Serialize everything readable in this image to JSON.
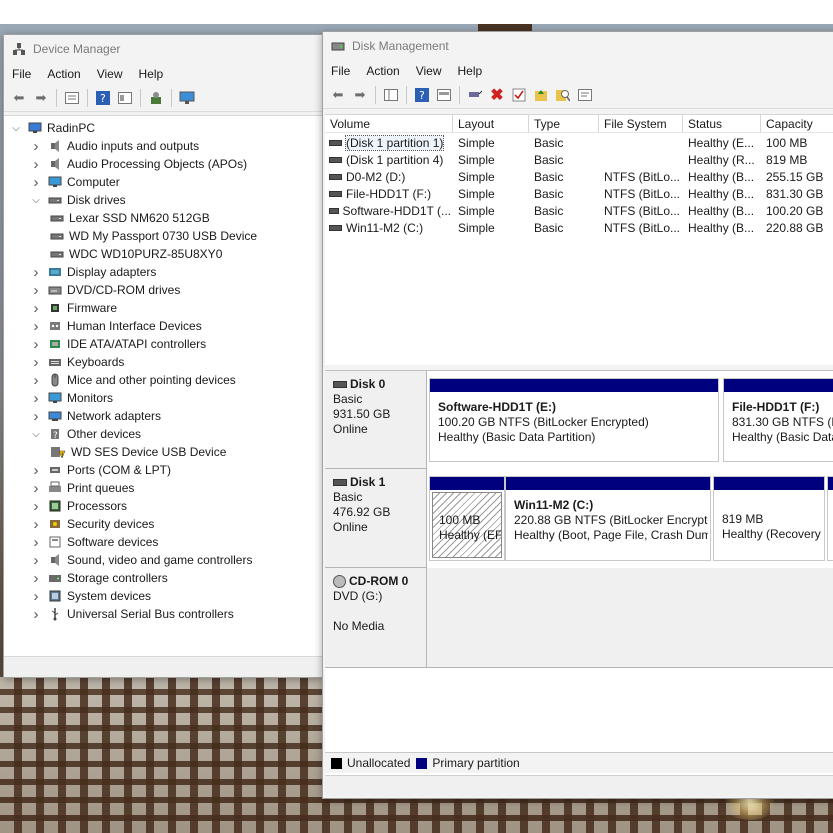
{
  "device_manager": {
    "title": "Device Manager",
    "menu": [
      "File",
      "Action",
      "View",
      "Help"
    ],
    "root": "RadinPC",
    "tree": [
      {
        "label": "Audio inputs and outputs",
        "level": 1,
        "exp": ">",
        "icon": "speaker-icon"
      },
      {
        "label": "Audio Processing Objects (APOs)",
        "level": 1,
        "exp": ">",
        "icon": "speaker-icon"
      },
      {
        "label": "Computer",
        "level": 1,
        "exp": ">",
        "icon": "monitor-icon"
      },
      {
        "label": "Disk drives",
        "level": 1,
        "exp": "v",
        "icon": "disk-drive-icon"
      },
      {
        "label": "Lexar SSD NM620 512GB",
        "level": 2,
        "exp": "",
        "icon": "disk-drive-icon"
      },
      {
        "label": "WD My Passport 0730 USB Device",
        "level": 2,
        "exp": "",
        "icon": "disk-drive-icon"
      },
      {
        "label": "WDC WD10PURZ-85U8XY0",
        "level": 2,
        "exp": "",
        "icon": "disk-drive-icon"
      },
      {
        "label": "Display adapters",
        "level": 1,
        "exp": ">",
        "icon": "display-adapter-icon"
      },
      {
        "label": "DVD/CD-ROM drives",
        "level": 1,
        "exp": ">",
        "icon": "dvd-drive-icon"
      },
      {
        "label": "Firmware",
        "level": 1,
        "exp": ">",
        "icon": "chip-icon"
      },
      {
        "label": "Human Interface Devices",
        "level": 1,
        "exp": ">",
        "icon": "hid-icon"
      },
      {
        "label": "IDE ATA/ATAPI controllers",
        "level": 1,
        "exp": ">",
        "icon": "controller-icon"
      },
      {
        "label": "Keyboards",
        "level": 1,
        "exp": ">",
        "icon": "keyboard-icon"
      },
      {
        "label": "Mice and other pointing devices",
        "level": 1,
        "exp": ">",
        "icon": "mouse-icon"
      },
      {
        "label": "Monitors",
        "level": 1,
        "exp": ">",
        "icon": "monitor-icon"
      },
      {
        "label": "Network adapters",
        "level": 1,
        "exp": ">",
        "icon": "network-adapter-icon"
      },
      {
        "label": "Other devices",
        "level": 1,
        "exp": "v",
        "icon": "unknown-device-icon"
      },
      {
        "label": "WD SES Device USB Device",
        "level": 2,
        "exp": "",
        "icon": "warning-device-icon"
      },
      {
        "label": "Ports (COM & LPT)",
        "level": 1,
        "exp": ">",
        "icon": "port-icon"
      },
      {
        "label": "Print queues",
        "level": 1,
        "exp": ">",
        "icon": "printer-icon"
      },
      {
        "label": "Processors",
        "level": 1,
        "exp": ">",
        "icon": "processor-icon"
      },
      {
        "label": "Security devices",
        "level": 1,
        "exp": ">",
        "icon": "security-device-icon"
      },
      {
        "label": "Software devices",
        "level": 1,
        "exp": ">",
        "icon": "software-device-icon"
      },
      {
        "label": "Sound, video and game controllers",
        "level": 1,
        "exp": ">",
        "icon": "speaker-icon"
      },
      {
        "label": "Storage controllers",
        "level": 1,
        "exp": ">",
        "icon": "storage-controller-icon"
      },
      {
        "label": "System devices",
        "level": 1,
        "exp": ">",
        "icon": "system-device-icon"
      },
      {
        "label": "Universal Serial Bus controllers",
        "level": 1,
        "exp": ">",
        "icon": "usb-icon"
      }
    ]
  },
  "disk_management": {
    "title": "Disk Management",
    "menu": [
      "File",
      "Action",
      "View",
      "Help"
    ],
    "columns": [
      "Volume",
      "Layout",
      "Type",
      "File System",
      "Status",
      "Capacity"
    ],
    "volumes": [
      [
        "(Disk 1 partition 1)",
        "Simple",
        "Basic",
        "",
        "Healthy (E...",
        "100 MB"
      ],
      [
        "(Disk 1 partition 4)",
        "Simple",
        "Basic",
        "",
        "Healthy (R...",
        "819 MB"
      ],
      [
        "D0-M2 (D:)",
        "Simple",
        "Basic",
        "NTFS (BitLo...",
        "Healthy (B...",
        "255.15 GB"
      ],
      [
        "File-HDD1T (F:)",
        "Simple",
        "Basic",
        "NTFS (BitLo...",
        "Healthy (B...",
        "831.30 GB"
      ],
      [
        "Software-HDD1T (...",
        "Simple",
        "Basic",
        "NTFS (BitLo...",
        "Healthy (B...",
        "100.20 GB"
      ],
      [
        "Win11-M2 (C:)",
        "Simple",
        "Basic",
        "NTFS (BitLo...",
        "Healthy (B...",
        "220.88 GB"
      ]
    ],
    "disks": [
      {
        "name": "Disk 0",
        "type": "Basic",
        "size": "931.50 GB",
        "state": "Online",
        "partitions": [
          {
            "name": "Software-HDD1T  (E:)",
            "detail": "100.20 GB NTFS (BitLocker Encrypted)",
            "status": "Healthy (Basic Data Partition)"
          },
          {
            "name": "File-HDD1T  (F:)",
            "detail": "831.30 GB NTFS (Bit",
            "status": "Healthy (Basic Data"
          }
        ]
      },
      {
        "name": "Disk 1",
        "type": "Basic",
        "size": "476.92 GB",
        "state": "Online",
        "partitions": [
          {
            "name": "",
            "detail": "100 MB",
            "status": "Healthy (EF"
          },
          {
            "name": "Win11-M2  (C:)",
            "detail": "220.88 GB NTFS (BitLocker Encryptec",
            "status": "Healthy (Boot, Page File, Crash Dum"
          },
          {
            "name": "",
            "detail": "819 MB",
            "status": "Healthy (Recovery"
          }
        ]
      },
      {
        "name": "CD-ROM 0",
        "type": "DVD (G:)",
        "size": "",
        "state": "No Media"
      }
    ],
    "legend": [
      {
        "label": "Unallocated",
        "color": "#000000"
      },
      {
        "label": "Primary partition",
        "color": "#00007f"
      }
    ]
  }
}
